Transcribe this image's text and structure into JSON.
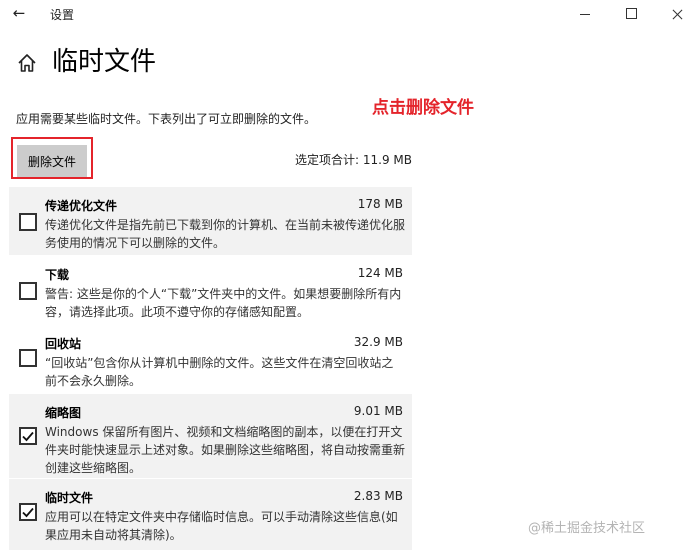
{
  "window": {
    "title": "设置"
  },
  "page": {
    "title": "临时文件",
    "intro": "应用需要某些临时文件。下表列出了可立即删除的文件。",
    "annotation": "点击删除文件",
    "delete_button": "删除文件",
    "selected_total": "选定项合计: 11.9 MB"
  },
  "items": [
    {
      "name": "传递优化文件",
      "size": "178 MB",
      "checked": false,
      "desc": "传递优化文件是指先前已下载到你的计算机、在当前未被传递优化服务使用的情况下可以删除的文件。"
    },
    {
      "name": "下载",
      "size": "124 MB",
      "checked": false,
      "desc": "警告: 这些是你的个人“下载”文件夹中的文件。如果想要删除所有内容，请选择此项。此项不遵守你的存储感知配置。"
    },
    {
      "name": "回收站",
      "size": "32.9 MB",
      "checked": false,
      "desc": "“回收站”包含你从计算机中删除的文件。这些文件在清空回收站之前不会永久删除。"
    },
    {
      "name": "缩略图",
      "size": "9.01 MB",
      "checked": true,
      "desc": "Windows 保留所有图片、视频和文档缩略图的副本，以便在打开文件夹时能快速显示上述对象。如果删除这些缩略图，将自动按需重新创建这些缩略图。"
    },
    {
      "name": "临时文件",
      "size": "2.83 MB",
      "checked": true,
      "desc": "应用可以在特定文件夹中存储临时信息。可以手动清除这些信息(如果应用未自动将其清除)。"
    }
  ],
  "watermark": "@稀土掘金技术社区",
  "icons": {
    "back": "back-arrow-icon",
    "home": "home-icon",
    "checkbox": "checkbox-icon"
  },
  "colors": {
    "annotation": "#e4242b",
    "button_bg": "#cccccc",
    "shaded_row": "#f2f2f2"
  }
}
